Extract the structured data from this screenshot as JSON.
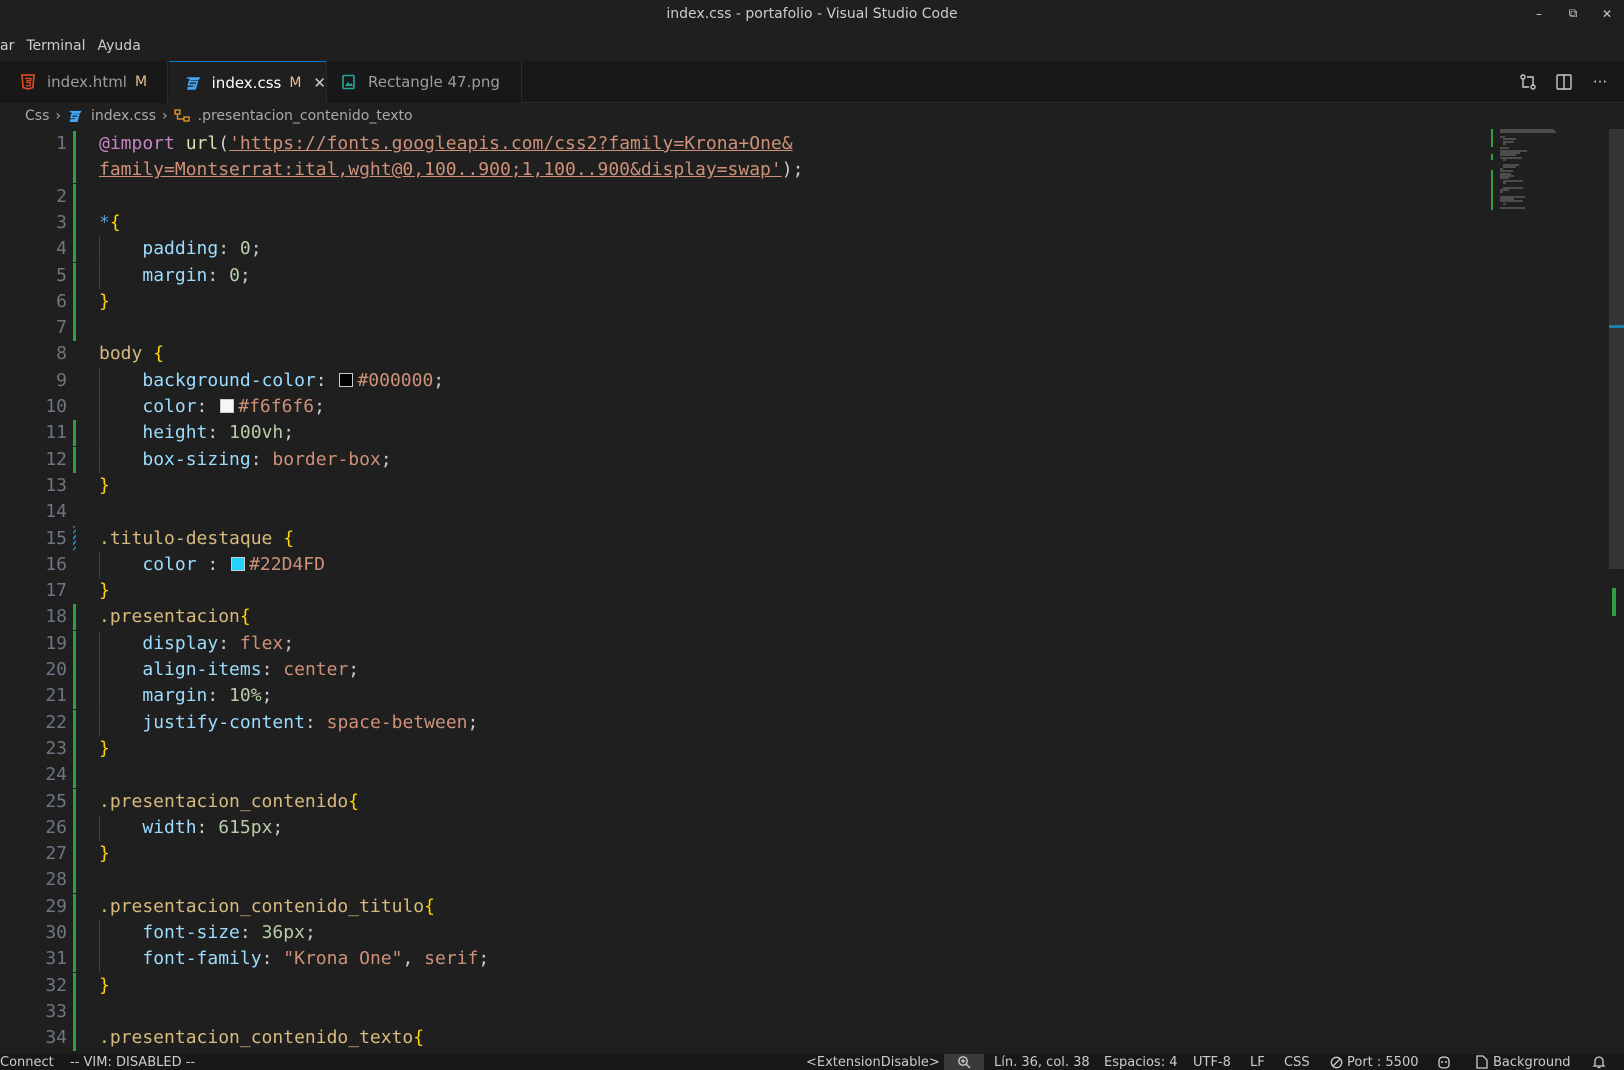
{
  "window": {
    "title": "index.css - portafolio - Visual Studio Code",
    "minimize": "–",
    "restore": "⧉",
    "close": "✕"
  },
  "menu": {
    "items": [
      "ar",
      "Terminal",
      "Ayuda"
    ]
  },
  "tabs": [
    {
      "label": "index.html",
      "status": "M",
      "icon": "html5-icon",
      "active": false
    },
    {
      "label": "index.css",
      "status": "M",
      "icon": "css3-icon",
      "active": true,
      "close": "✕"
    },
    {
      "label": "Rectangle 47.png",
      "status": "",
      "icon": "image-file-icon",
      "active": false
    }
  ],
  "tab_actions": {
    "compare_icon": "git-compare-icon",
    "split_icon": "split-editor-icon",
    "more_icon": "ellipsis-icon",
    "more_label": "···"
  },
  "breadcrumb": {
    "items": [
      "Css",
      "index.css",
      ".presentacion_contenido_texto"
    ]
  },
  "editor": {
    "lines": [
      {
        "n": "1",
        "git": "add",
        "tokens": [
          [
            "t-at",
            "@import"
          ],
          [
            "t-p",
            " "
          ],
          [
            "t-fn",
            "url"
          ],
          [
            "t-p",
            "("
          ],
          [
            "t-url",
            "'https://fonts.googleapis.com/css2?family=Krona+One&"
          ]
        ]
      },
      {
        "n": "",
        "git": "add",
        "tokens": [
          [
            "t-url",
            "family=Montserrat:ital,wght@0,100..900;1,100..900&display=swap'"
          ],
          [
            "t-p",
            ");"
          ]
        ]
      },
      {
        "n": "2",
        "git": "add",
        "tokens": []
      },
      {
        "n": "3",
        "git": "add",
        "tokens": [
          [
            "t-star",
            "*"
          ],
          [
            "t-brk",
            "{"
          ]
        ]
      },
      {
        "n": "4",
        "git": "add",
        "indent": true,
        "tokens": [
          [
            "t-p",
            "    "
          ],
          [
            "t-prop",
            "padding"
          ],
          [
            "t-p",
            ": "
          ],
          [
            "t-num",
            "0"
          ],
          [
            "t-p",
            ";"
          ]
        ]
      },
      {
        "n": "5",
        "git": "add",
        "indent": true,
        "tokens": [
          [
            "t-p",
            "    "
          ],
          [
            "t-prop",
            "margin"
          ],
          [
            "t-p",
            ": "
          ],
          [
            "t-num",
            "0"
          ],
          [
            "t-p",
            ";"
          ]
        ]
      },
      {
        "n": "6",
        "git": "add",
        "tokens": [
          [
            "t-brk",
            "}"
          ]
        ]
      },
      {
        "n": "7",
        "git": "add",
        "tokens": []
      },
      {
        "n": "8",
        "git": "",
        "tokens": [
          [
            "t-sel",
            "body"
          ],
          [
            "t-p",
            " "
          ],
          [
            "t-brk",
            "{"
          ]
        ]
      },
      {
        "n": "9",
        "git": "",
        "indent": true,
        "swatch": "#000000",
        "tokens": [
          [
            "t-p",
            "    "
          ],
          [
            "t-prop",
            "background-color"
          ],
          [
            "t-p",
            ": "
          ],
          [
            "swatch",
            ""
          ],
          [
            "t-val",
            "#000000"
          ],
          [
            "t-p",
            ";"
          ]
        ]
      },
      {
        "n": "10",
        "git": "",
        "indent": true,
        "swatch": "#f6f6f6",
        "tokens": [
          [
            "t-p",
            "    "
          ],
          [
            "t-prop",
            "color"
          ],
          [
            "t-p",
            ": "
          ],
          [
            "swatch",
            ""
          ],
          [
            "t-val",
            "#f6f6f6"
          ],
          [
            "t-p",
            ";"
          ]
        ]
      },
      {
        "n": "11",
        "git": "add",
        "indent": true,
        "tokens": [
          [
            "t-p",
            "    "
          ],
          [
            "t-prop",
            "height"
          ],
          [
            "t-p",
            ": "
          ],
          [
            "t-num",
            "100vh"
          ],
          [
            "t-p",
            ";"
          ]
        ]
      },
      {
        "n": "12",
        "git": "add",
        "indent": true,
        "tokens": [
          [
            "t-p",
            "    "
          ],
          [
            "t-prop",
            "box-sizing"
          ],
          [
            "t-p",
            ": "
          ],
          [
            "t-val",
            "border-box"
          ],
          [
            "t-p",
            ";"
          ]
        ]
      },
      {
        "n": "13",
        "git": "",
        "tokens": [
          [
            "t-brk",
            "}"
          ]
        ]
      },
      {
        "n": "14",
        "git": "",
        "tokens": []
      },
      {
        "n": "15",
        "git": "mod",
        "tokens": [
          [
            "t-sel",
            ".titulo-destaque"
          ],
          [
            "t-p",
            " "
          ],
          [
            "t-brk",
            "{"
          ]
        ]
      },
      {
        "n": "16",
        "git": "",
        "indent": true,
        "swatch": "#22D4FD",
        "tokens": [
          [
            "t-p",
            "    "
          ],
          [
            "t-prop",
            "color"
          ],
          [
            "t-p",
            " : "
          ],
          [
            "swatch",
            ""
          ],
          [
            "t-val",
            "#22D4FD"
          ]
        ]
      },
      {
        "n": "17",
        "git": "",
        "tokens": [
          [
            "t-brk",
            "}"
          ]
        ]
      },
      {
        "n": "18",
        "git": "add",
        "tokens": [
          [
            "t-sel",
            ".presentacion"
          ],
          [
            "t-brk",
            "{"
          ]
        ]
      },
      {
        "n": "19",
        "git": "add",
        "indent": true,
        "tokens": [
          [
            "t-p",
            "    "
          ],
          [
            "t-prop",
            "display"
          ],
          [
            "t-p",
            ": "
          ],
          [
            "t-val",
            "flex"
          ],
          [
            "t-p",
            ";"
          ]
        ]
      },
      {
        "n": "20",
        "git": "add",
        "indent": true,
        "tokens": [
          [
            "t-p",
            "    "
          ],
          [
            "t-prop",
            "align-items"
          ],
          [
            "t-p",
            ": "
          ],
          [
            "t-val",
            "center"
          ],
          [
            "t-p",
            ";"
          ]
        ]
      },
      {
        "n": "21",
        "git": "add",
        "indent": true,
        "tokens": [
          [
            "t-p",
            "    "
          ],
          [
            "t-prop",
            "margin"
          ],
          [
            "t-p",
            ": "
          ],
          [
            "t-num",
            "10%"
          ],
          [
            "t-p",
            ";"
          ]
        ]
      },
      {
        "n": "22",
        "git": "add",
        "indent": true,
        "tokens": [
          [
            "t-p",
            "    "
          ],
          [
            "t-prop",
            "justify-content"
          ],
          [
            "t-p",
            ": "
          ],
          [
            "t-val",
            "space-between"
          ],
          [
            "t-p",
            ";"
          ]
        ]
      },
      {
        "n": "23",
        "git": "add",
        "tokens": [
          [
            "t-brk",
            "}"
          ]
        ]
      },
      {
        "n": "24",
        "git": "add",
        "tokens": []
      },
      {
        "n": "25",
        "git": "add",
        "tokens": [
          [
            "t-sel",
            ".presentacion_contenido"
          ],
          [
            "t-brk",
            "{"
          ]
        ]
      },
      {
        "n": "26",
        "git": "add",
        "indent": true,
        "tokens": [
          [
            "t-p",
            "    "
          ],
          [
            "t-prop",
            "width"
          ],
          [
            "t-p",
            ": "
          ],
          [
            "t-num",
            "615px"
          ],
          [
            "t-p",
            ";"
          ]
        ]
      },
      {
        "n": "27",
        "git": "add",
        "tokens": [
          [
            "t-brk",
            "}"
          ]
        ]
      },
      {
        "n": "28",
        "git": "add",
        "tokens": []
      },
      {
        "n": "29",
        "git": "add",
        "tokens": [
          [
            "t-sel",
            ".presentacion_contenido_titulo"
          ],
          [
            "t-brk",
            "{"
          ]
        ]
      },
      {
        "n": "30",
        "git": "add",
        "indent": true,
        "tokens": [
          [
            "t-p",
            "    "
          ],
          [
            "t-prop",
            "font-size"
          ],
          [
            "t-p",
            ": "
          ],
          [
            "t-num",
            "36px"
          ],
          [
            "t-p",
            ";"
          ]
        ]
      },
      {
        "n": "31",
        "git": "add",
        "indent": true,
        "tokens": [
          [
            "t-p",
            "    "
          ],
          [
            "t-prop",
            "font-family"
          ],
          [
            "t-p",
            ": "
          ],
          [
            "t-val",
            "\"Krona One\""
          ],
          [
            "t-p",
            ", "
          ],
          [
            "t-val",
            "serif"
          ],
          [
            "t-p",
            ";"
          ]
        ]
      },
      {
        "n": "32",
        "git": "add",
        "tokens": [
          [
            "t-brk",
            "}"
          ]
        ]
      },
      {
        "n": "33",
        "git": "add",
        "tokens": []
      },
      {
        "n": "34",
        "git": "add",
        "tokens": [
          [
            "t-sel",
            ".presentacion_contenido_texto"
          ],
          [
            "t-brk",
            "{"
          ]
        ]
      }
    ]
  },
  "statusbar": {
    "connect": "Connect",
    "vim": "-- VIM: DISABLED --",
    "extension": "<ExtensionDisable>",
    "zoom_icon": "zoom-in-icon",
    "position": "Lín. 36, col. 38",
    "spaces": "Espacios: 4",
    "encoding": "UTF-8",
    "eol": "LF",
    "language": "CSS",
    "port": "Port : 5500",
    "copilot_icon": "copilot-icon",
    "background": "Background",
    "bell_icon": "bell-icon"
  },
  "colors": {
    "accent": "#0078d4",
    "git_added": "#2ea043",
    "git_modified": "#1b81a8",
    "modified_badge": "#e2c08d"
  }
}
